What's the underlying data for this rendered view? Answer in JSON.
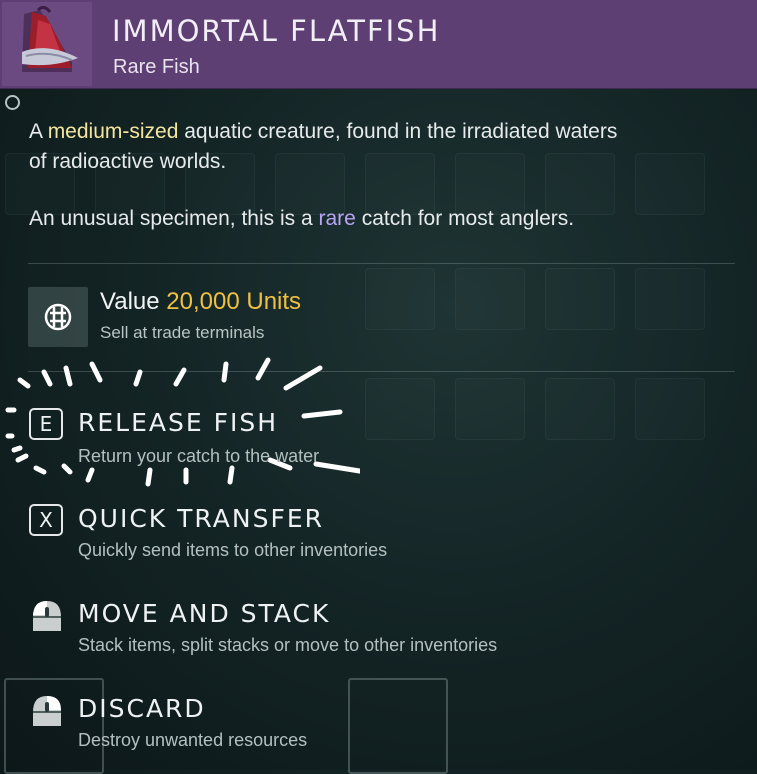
{
  "header": {
    "title": "IMMORTAL FLATFISH",
    "subtitle": "Rare Fish",
    "icon": "flatfish-icon",
    "bg_color": "#5e3f73"
  },
  "description": {
    "line1_prefix": "A ",
    "line1_highlight": "medium-sized",
    "line1_suffix": " aquatic creature, found in the irradiated waters",
    "line2": "of radioactive worlds.",
    "line3_prefix": "An unusual specimen, this is a ",
    "line3_highlight": "rare",
    "line3_suffix": " catch for most anglers."
  },
  "value": {
    "label": "Value",
    "amount": "20,000 Units",
    "sub": "Sell at trade terminals",
    "icon": "units-currency-icon",
    "amount_color": "#f0c040"
  },
  "actions": [
    {
      "key": "E",
      "title": "RELEASE FISH",
      "sub": "Return your catch to the water",
      "icon": "key-e-icon"
    },
    {
      "key": "X",
      "title": "QUICK TRANSFER",
      "sub": "Quickly send items to other inventories",
      "icon": "key-x-icon"
    },
    {
      "key": "",
      "title": "MOVE AND STACK",
      "sub": "Stack items, split stacks or move to other inventories",
      "icon": "mouse-left-click-icon"
    },
    {
      "key": "",
      "title": "DISCARD",
      "sub": "Destroy unwanted resources",
      "icon": "mouse-right-click-icon"
    }
  ]
}
